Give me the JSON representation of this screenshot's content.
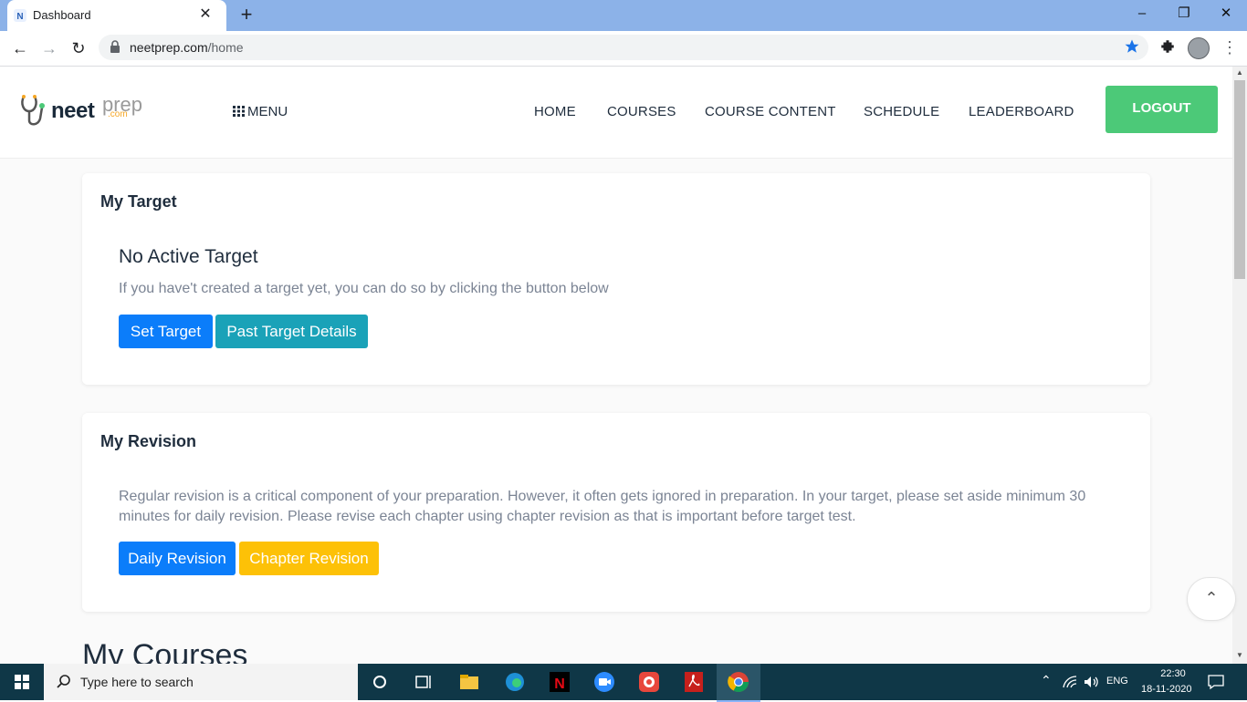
{
  "browser": {
    "tab_title": "Dashboard",
    "url_domain": "neetprep.com",
    "url_path": "/home",
    "window_controls": [
      "minimize",
      "restore",
      "close"
    ]
  },
  "header": {
    "logo_text_main": "neet",
    "logo_text_accent": "prep",
    "logo_text_small": ".com",
    "menu_label": "MENU",
    "nav": [
      "HOME",
      "COURSES",
      "COURSE CONTENT",
      "SCHEDULE",
      "LEADERBOARD"
    ],
    "logout_label": "LOGOUT"
  },
  "target_card": {
    "title": "My Target",
    "subtitle": "No Active Target",
    "description": "If you have't created a target yet, you can do so by clicking the button below",
    "btn_set": "Set Target",
    "btn_past": "Past Target Details"
  },
  "revision_card": {
    "title": "My Revision",
    "description": "Regular revision is a critical component of your preparation. However, it often gets ignored in preparation. In your target, please set aside minimum 30 minutes for daily revision. Please revise each chapter using chapter revision as that is important before target test.",
    "btn_daily": "Daily Revision",
    "btn_chapter": "Chapter Revision"
  },
  "courses_heading": "My Courses",
  "taskbar": {
    "search_placeholder": "Type here to search",
    "lang": "ENG",
    "time": "22:30",
    "date": "18-11-2020"
  },
  "colors": {
    "primary": "#0b7dfa",
    "info": "#1aa2b8",
    "warning": "#fdc107",
    "success": "#4cc978"
  }
}
